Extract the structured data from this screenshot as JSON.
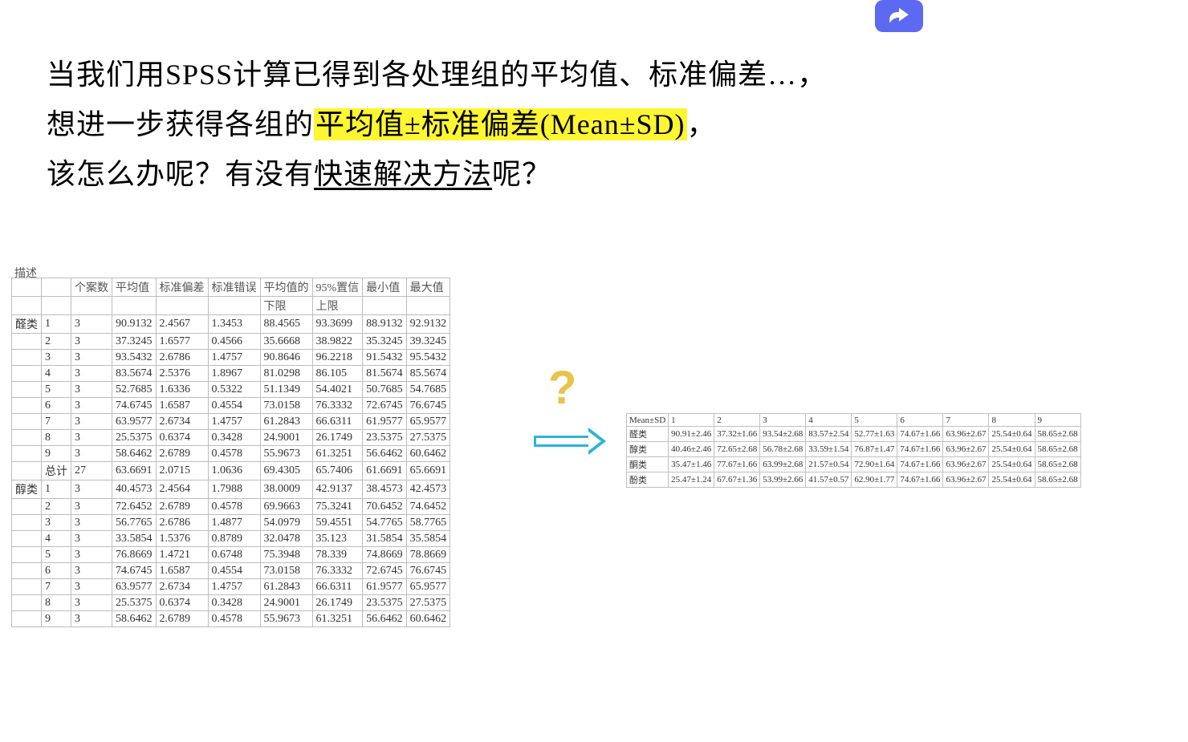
{
  "headline": {
    "line1_pre": "当我们用SPSS计算已得到各处理组的平均值、标准偏差…，",
    "line2_pre": "想进一步获得各组的",
    "line2_highlight": "平均值±标准偏差(Mean±SD)",
    "line2_post": "，",
    "line3_pre": "该怎么办呢？有没有",
    "line3_underline": "快速解决方法",
    "line3_post": "呢？"
  },
  "desc_label": "描述",
  "spss_headers": {
    "blank1": "",
    "blank2": "",
    "h1": "个案数",
    "h2": "平均值",
    "h3": "标准偏差",
    "h4": "标准错误",
    "h5": "平均值的",
    "h6": "95%置信",
    "h7": "最小值",
    "h8": "最大值",
    "sub5": "下限",
    "sub6": "上限"
  },
  "spss_groups": [
    "醛类",
    "醇类"
  ],
  "spss_rows": [
    [
      "醛类",
      "1",
      "3",
      "90.9132",
      "2.4567",
      "1.3453",
      "88.4565",
      "93.3699",
      "88.9132",
      "92.9132"
    ],
    [
      "",
      "2",
      "3",
      "37.3245",
      "1.6577",
      "0.4566",
      "35.6668",
      "38.9822",
      "35.3245",
      "39.3245"
    ],
    [
      "",
      "3",
      "3",
      "93.5432",
      "2.6786",
      "1.4757",
      "90.8646",
      "96.2218",
      "91.5432",
      "95.5432"
    ],
    [
      "",
      "4",
      "3",
      "83.5674",
      "2.5376",
      "1.8967",
      "81.0298",
      "86.105",
      "81.5674",
      "85.5674"
    ],
    [
      "",
      "5",
      "3",
      "52.7685",
      "1.6336",
      "0.5322",
      "51.1349",
      "54.4021",
      "50.7685",
      "54.7685"
    ],
    [
      "",
      "6",
      "3",
      "74.6745",
      "1.6587",
      "0.4554",
      "73.0158",
      "76.3332",
      "72.6745",
      "76.6745"
    ],
    [
      "",
      "7",
      "3",
      "63.9577",
      "2.6734",
      "1.4757",
      "61.2843",
      "66.6311",
      "61.9577",
      "65.9577"
    ],
    [
      "",
      "8",
      "3",
      "25.5375",
      "0.6374",
      "0.3428",
      "24.9001",
      "26.1749",
      "23.5375",
      "27.5375"
    ],
    [
      "",
      "9",
      "3",
      "58.6462",
      "2.6789",
      "0.4578",
      "55.9673",
      "61.3251",
      "56.6462",
      "60.6462"
    ],
    [
      "",
      "总计",
      "27",
      "63.6691",
      "2.0715",
      "1.0636",
      "69.4305",
      "65.7406",
      "61.6691",
      "65.6691"
    ],
    [
      "醇类",
      "1",
      "3",
      "40.4573",
      "2.4564",
      "1.7988",
      "38.0009",
      "42.9137",
      "38.4573",
      "42.4573"
    ],
    [
      "",
      "2",
      "3",
      "72.6452",
      "2.6789",
      "0.4578",
      "69.9663",
      "75.3241",
      "70.6452",
      "74.6452"
    ],
    [
      "",
      "3",
      "3",
      "56.7765",
      "2.6786",
      "1.4877",
      "54.0979",
      "59.4551",
      "54.7765",
      "58.7765"
    ],
    [
      "",
      "4",
      "3",
      "33.5854",
      "1.5376",
      "0.8789",
      "32.0478",
      "35.123",
      "31.5854",
      "35.5854"
    ],
    [
      "",
      "5",
      "3",
      "76.8669",
      "1.4721",
      "0.6748",
      "75.3948",
      "78.339",
      "74.8669",
      "78.8669"
    ],
    [
      "",
      "6",
      "3",
      "74.6745",
      "1.6587",
      "0.4554",
      "73.0158",
      "76.3332",
      "72.6745",
      "76.6745"
    ],
    [
      "",
      "7",
      "3",
      "63.9577",
      "2.6734",
      "1.4757",
      "61.2843",
      "66.6311",
      "61.9577",
      "65.9577"
    ],
    [
      "",
      "8",
      "3",
      "25.5375",
      "0.6374",
      "0.3428",
      "24.9001",
      "26.1749",
      "23.5375",
      "27.5375"
    ],
    [
      "",
      "9",
      "3",
      "58.6462",
      "2.6789",
      "0.4578",
      "55.9673",
      "61.3251",
      "56.6462",
      "60.6462"
    ]
  ],
  "question_mark": "?",
  "result_headers": [
    "Mean±SD",
    "1",
    "2",
    "3",
    "4",
    "5",
    "6",
    "7",
    "8",
    "9"
  ],
  "result_rows": [
    [
      "醛类",
      "90.91±2.46",
      "37.32±1.66",
      "93.54±2.68",
      "83.57±2.54",
      "52.77±1.63",
      "74.67±1.66",
      "63.96±2.67",
      "25.54±0.64",
      "58.65±2.68"
    ],
    [
      "醇类",
      "40.46±2.46",
      "72.65±2.68",
      "56.78±2.68",
      "33.59±1.54",
      "76.87±1.47",
      "74.67±1.66",
      "63.96±2.67",
      "25.54±0.64",
      "58.65±2.68"
    ],
    [
      "酮类",
      "35.47±1.46",
      "77.67±1.66",
      "63.99±2.68",
      "21.57±0.54",
      "72.90±1.64",
      "74.67±1.66",
      "63.96±2.67",
      "25.54±0.64",
      "58.65±2.68"
    ],
    [
      "酚类",
      "25.47±1.24",
      "67.67±1.36",
      "53.99±2.66",
      "41.57±0.57",
      "62.90±1.77",
      "74.67±1.66",
      "63.96±2.67",
      "25.54±0.64",
      "58.65±2.68"
    ]
  ]
}
